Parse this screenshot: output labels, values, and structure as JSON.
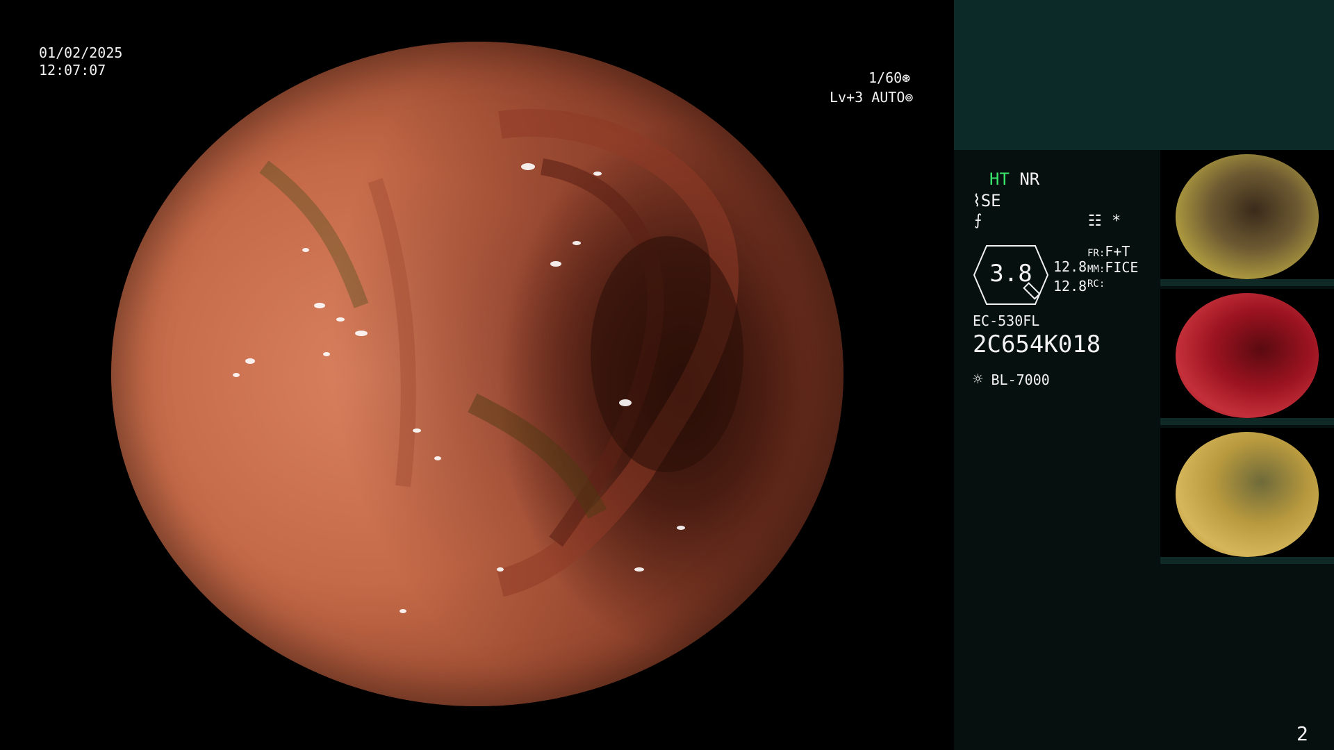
{
  "osd": {
    "date": "01/02/2025",
    "time": "12:07:07",
    "shutter": "1/60",
    "level": "Lv+3 AUTO"
  },
  "panel": {
    "ht": "HT",
    "nr": "NR",
    "se": "SE",
    "hex_value": "3.8",
    "val1": "12.8",
    "val2": "12.8",
    "fr_label": "FR:",
    "fr_value": "F+T",
    "mm_label": "MM:",
    "mm_value": "FICE",
    "rc_label": "RC:",
    "scope_model": "EC-530FL",
    "serial": "2C654K018",
    "light_source": "BL-7000",
    "page_number": "2"
  },
  "icons": {
    "shutter": "shutter-icon",
    "auto": "auto-iris-icon",
    "se": "se-icon",
    "extra": "slash-icon",
    "menu": "menu-icon",
    "asterisk": "asterisk-icon",
    "light": "lamp-icon"
  },
  "colors": {
    "panel_top": "#0c2a27",
    "panel_main": "#06110f",
    "ht_green": "#39e66b"
  }
}
